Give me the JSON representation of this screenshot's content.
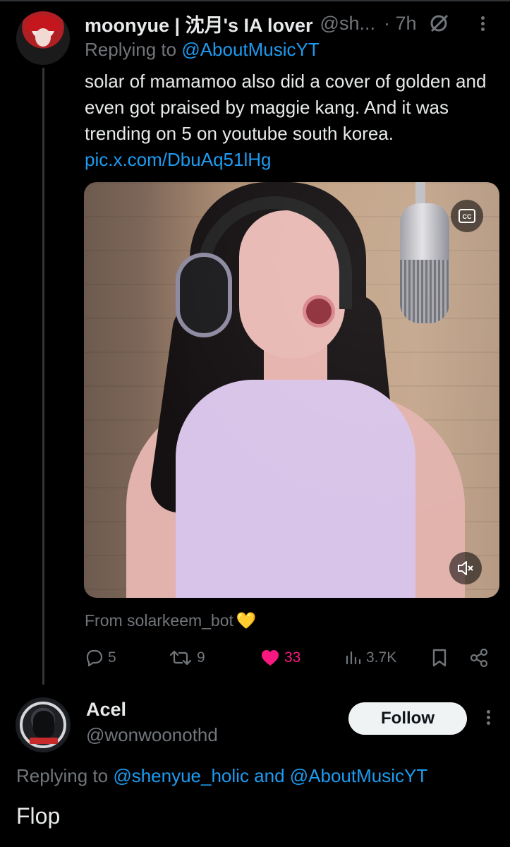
{
  "post1": {
    "display_name": "moonyue | 沈月's IA lover",
    "handle": "@sh...",
    "time": "· 7h",
    "replying_prefix": "Replying to ",
    "replying_to": "@AboutMusicYT",
    "text": "solar of mamamoo also did a cover of golden and even got praised by maggie kang. And it was trending on 5 on youtube south korea.",
    "link": "pic.x.com/DbuAq51lHg",
    "media_cc_label": "CC",
    "from_text": "From solarkeem_bot",
    "from_emoji": "💛",
    "actions": {
      "replies": "5",
      "reposts": "9",
      "likes": "33",
      "views": "3.7K"
    },
    "like_color": "#f91880"
  },
  "post2": {
    "display_name": "Acel",
    "handle": "@wonwoonothd",
    "follow_label": "Follow",
    "replying_prefix": "Replying to ",
    "replying_to_1": "@shenyue_holic",
    "replying_and": " and ",
    "replying_to_2": "@AboutMusicYT",
    "text": "Flop"
  },
  "colors": {
    "background": "#000000",
    "text": "#e7e9ea",
    "muted": "#71767b",
    "link": "#1d9bf0",
    "like": "#f91880"
  }
}
